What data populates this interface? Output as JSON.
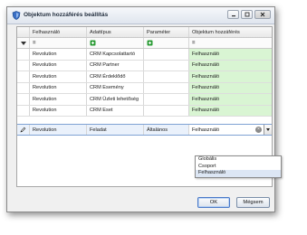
{
  "window": {
    "title": "Objektum hozzáférés beállítás",
    "icon": "shield-icon",
    "controls": [
      "minimize-icon",
      "maximize-icon",
      "close-icon"
    ]
  },
  "grid": {
    "columns": [
      "Felhasználó",
      "Adattípus",
      "Paraméter",
      "Objektum hozzáférés"
    ],
    "filter_row": {
      "c1": "=",
      "c2": "rule-icon",
      "c3": "rule-icon",
      "c4": "="
    },
    "rows": [
      {
        "user": "Revolution",
        "type": "CRM Kapcsolattartó",
        "param": "",
        "access": "Felhasználó"
      },
      {
        "user": "Revolution",
        "type": "CRM Partner",
        "param": "",
        "access": "Felhasználó"
      },
      {
        "user": "Revolution",
        "type": "CRM Érdeklődő",
        "param": "",
        "access": "Felhasználó"
      },
      {
        "user": "Revolution",
        "type": "CRM Esemény",
        "param": "",
        "access": "Felhasználó"
      },
      {
        "user": "Revolution",
        "type": "CRM Üzleti lehetőség",
        "param": "",
        "access": "Felhasználó"
      },
      {
        "user": "Revolution",
        "type": "CRM Eset",
        "param": "",
        "access": "Felhasználó"
      }
    ],
    "active_row": {
      "user": "Revolution",
      "type": "Feladat",
      "param": "Általános",
      "access": "Felhasználó"
    }
  },
  "dropdown": {
    "options": [
      "Globális",
      "Csoport",
      "Felhasználó"
    ],
    "selected": "Felhasználó"
  },
  "buttons": {
    "ok": "OK",
    "cancel": "Mégsem"
  },
  "colors": {
    "access_cell_bg": "#d9f5d3",
    "active_row_bg": "#eaf1fb",
    "rule_icon": "#2f9e3a"
  }
}
